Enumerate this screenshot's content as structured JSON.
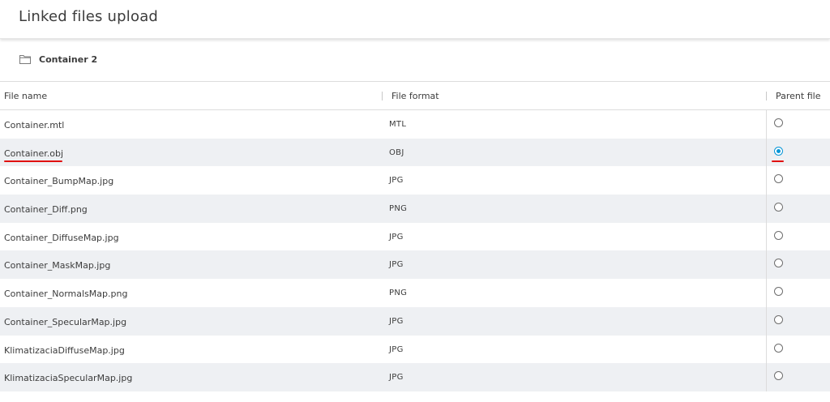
{
  "header": {
    "title": "Linked files upload"
  },
  "breadcrumb": {
    "label": "Container 2",
    "icon": "folder-icon"
  },
  "table": {
    "columns": [
      "File name",
      "File format",
      "Parent file"
    ],
    "rows": [
      {
        "name": "Container.mtl",
        "format": "MTL",
        "parent": false
      },
      {
        "name": "Container.obj",
        "format": "OBJ",
        "parent": true
      },
      {
        "name": "Container_BumpMap.jpg",
        "format": "JPG",
        "parent": false
      },
      {
        "name": "Container_Diff.png",
        "format": "PNG",
        "parent": false
      },
      {
        "name": "Container_DiffuseMap.jpg",
        "format": "JPG",
        "parent": false
      },
      {
        "name": "Container_MaskMap.jpg",
        "format": "JPG",
        "parent": false
      },
      {
        "name": "Container_NormalsMap.png",
        "format": "PNG",
        "parent": false
      },
      {
        "name": "Container_SpecularMap.jpg",
        "format": "JPG",
        "parent": false
      },
      {
        "name": "KlimatizaciaDiffuseMap.jpg",
        "format": "JPG",
        "parent": false
      },
      {
        "name": "KlimatizaciaSpecularMap.jpg",
        "format": "JPG",
        "parent": false
      }
    ]
  },
  "colors": {
    "accent": "#0696d7",
    "annotation": "#e01010",
    "row_alt": "#eef0f3"
  }
}
